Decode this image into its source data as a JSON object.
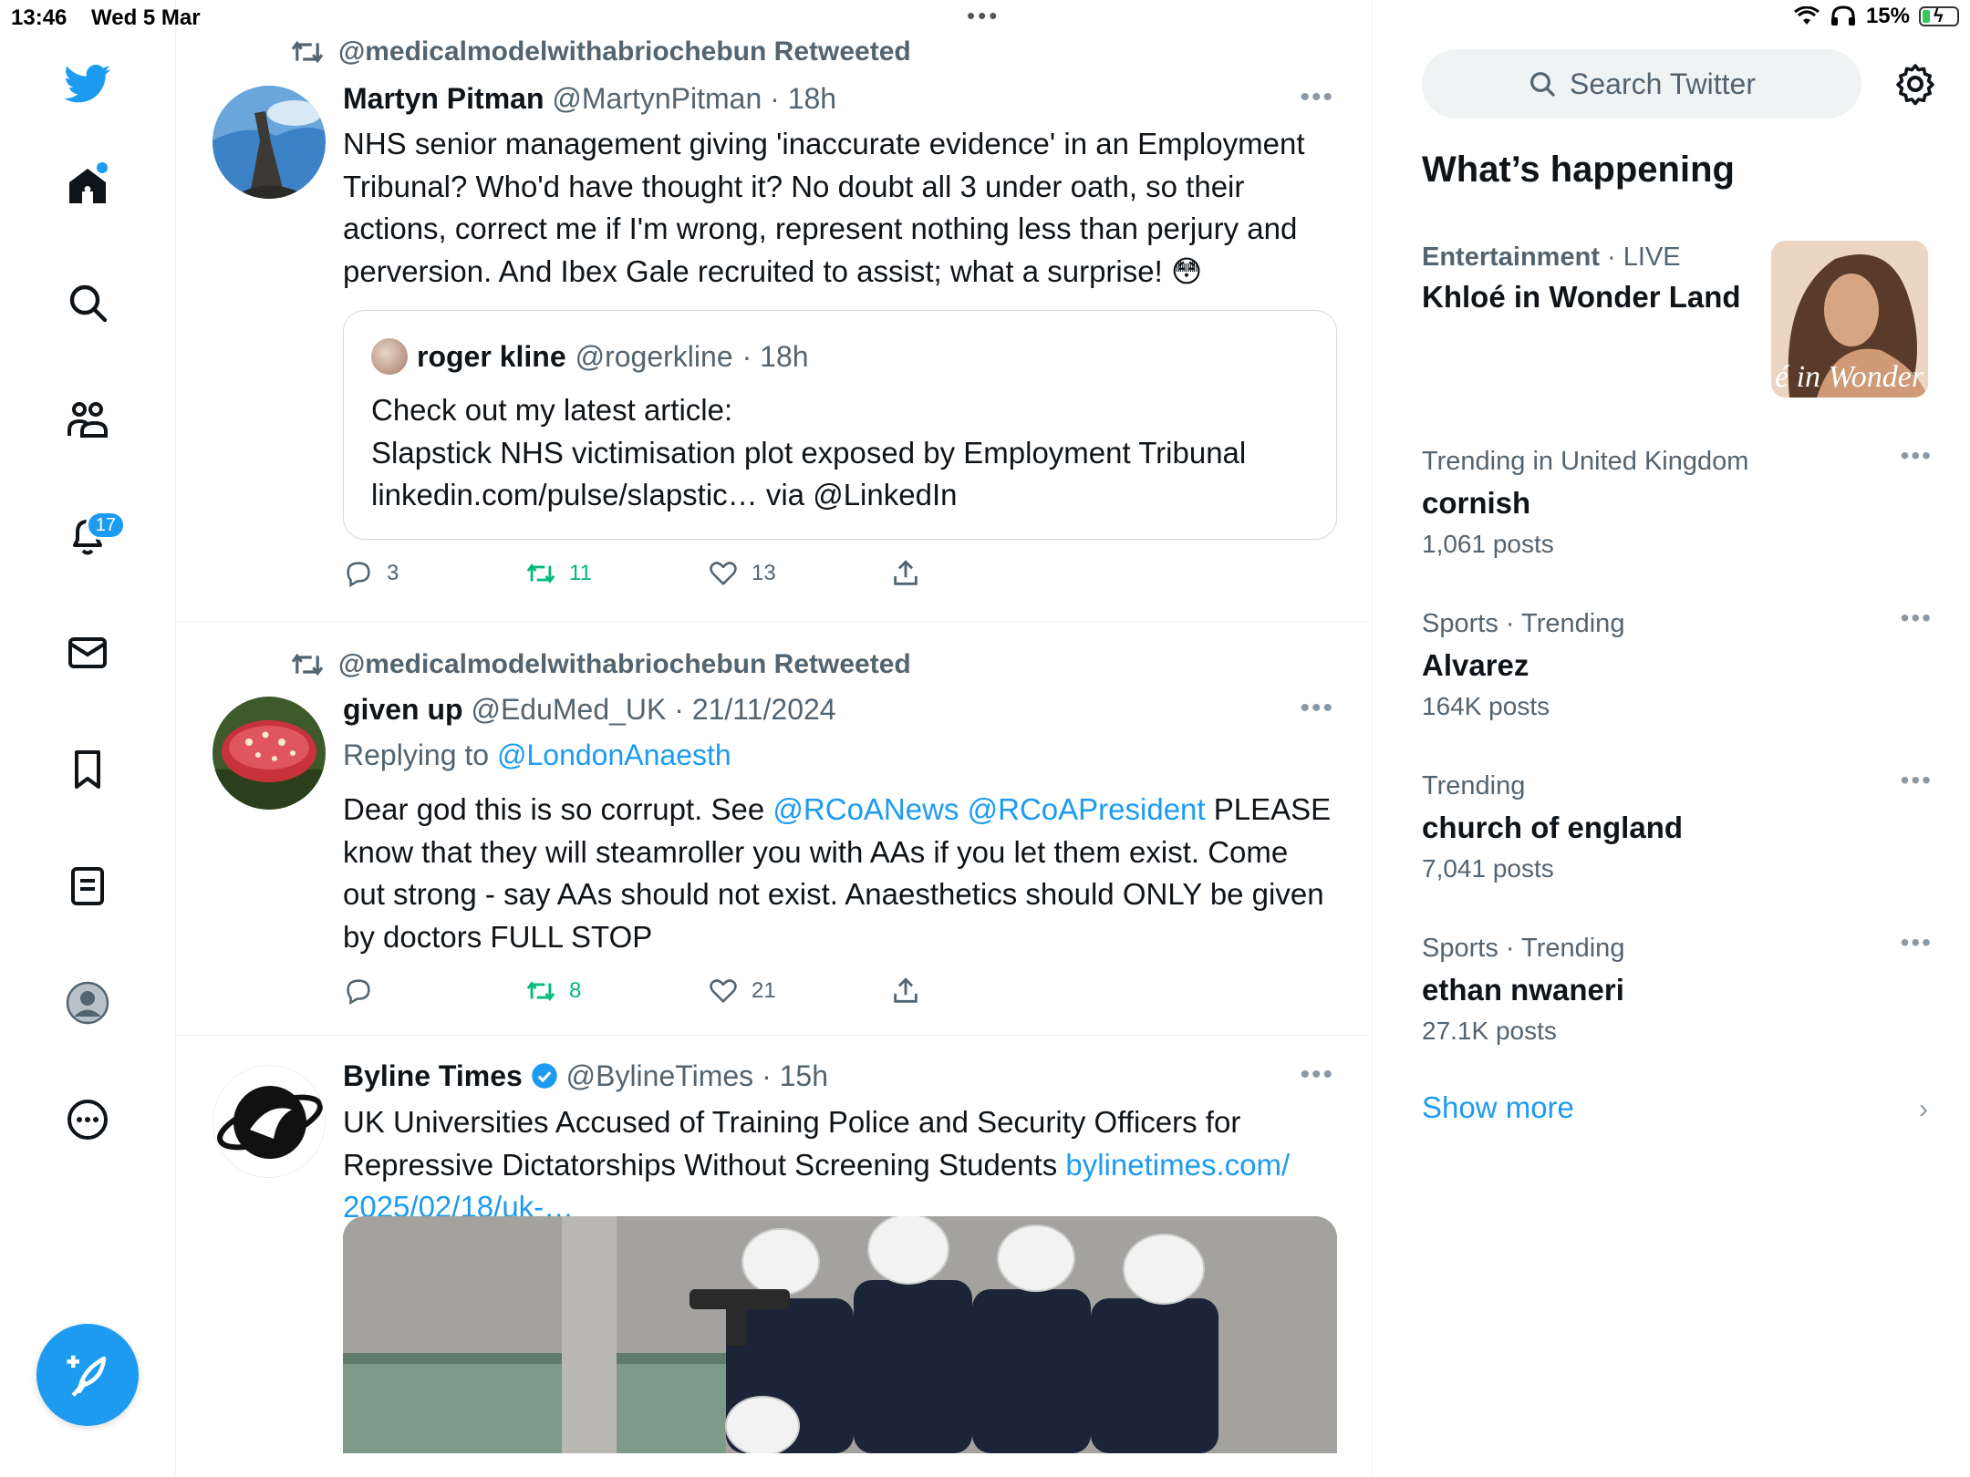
{
  "status_bar": {
    "time": "13:46",
    "date": "Wed 5 Mar",
    "battery": "15%"
  },
  "nav": {
    "notifications_count": "17"
  },
  "tweets": [
    {
      "retweeted_by": "@medicalmodelwithabriochebun Retweeted",
      "name": "Martyn Pitman",
      "handle": "@MartynPitman",
      "time": "· 18h",
      "text": "NHS senior management giving 'inaccurate evidence' in an Employment Tribunal? Who'd have thought it? No doubt all 3 under oath, so their actions, correct me if I'm wrong, represent nothing less than perjury and perversion. And Ibex Gale recruited to assist; what a surprise! 😳",
      "quote": {
        "name": "roger kline",
        "handle": "@rogerkline",
        "time": "· 18h",
        "line1": "Check out my latest article:",
        "line2": "Slapstick NHS victimisation plot exposed by Employment Tribunal",
        "line3": "linkedin.com/pulse/slapstic… via @LinkedIn"
      },
      "replies": "3",
      "retweets": "11",
      "likes": "13"
    },
    {
      "retweeted_by": "@medicalmodelwithabriochebun Retweeted",
      "name": "given up",
      "handle": "@EduMed_UK",
      "time": "· 21/11/2024",
      "replying_label": "Replying to",
      "replying_to": "@LondonAnaesth",
      "text_before": "Dear god this is so corrupt. See",
      "mention1": "@RCoANews",
      "mention2": "@RCoAPresident",
      "text_after": "PLEASE know that they will steamroller you with AAs if you let them exist. Come out strong - say AAs should not exist. Anaesthetics should ONLY be given by doctors FULL STOP",
      "replies": "",
      "retweets": "8",
      "likes": "21"
    },
    {
      "name": "Byline Times",
      "handle": "@BylineTimes",
      "time": "· 15h",
      "text": "UK Universities Accused of Training Police and Security Officers for Repressive Dictatorships Without Screening Students",
      "link1": "bylinetimes.com/",
      "link2": "2025/02/18/uk-…"
    }
  ],
  "sidebar": {
    "search_placeholder": "Search Twitter",
    "title": "What’s happening",
    "featured": {
      "category": "Entertainment",
      "status": "· LIVE",
      "title": "Khloé in Wonder Land",
      "image_text": "é in Wonder L"
    },
    "trends": [
      {
        "meta": "Trending in United Kingdom",
        "name": "cornish",
        "count": "1,061 posts"
      },
      {
        "meta": "Sports · Trending",
        "name": "Alvarez",
        "count": "164K posts"
      },
      {
        "meta": "Trending",
        "name": "church of england",
        "count": "7,041 posts"
      },
      {
        "meta": "Sports · Trending",
        "name": "ethan nwaneri",
        "count": "27.1K posts"
      }
    ],
    "show_more": "Show more"
  },
  "colors": {
    "accent": "#1d9bf0",
    "retweet_green": "#00ba7c",
    "secondary_text": "#536471"
  }
}
